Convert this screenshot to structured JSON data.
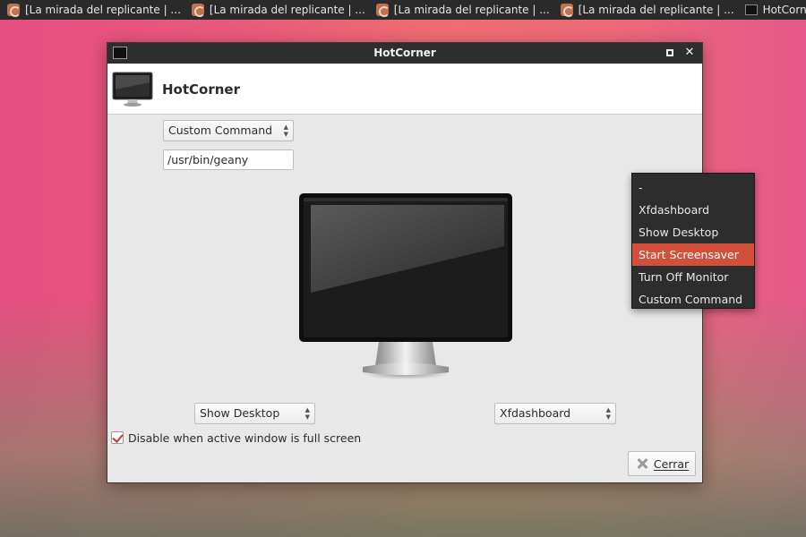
{
  "taskbar": {
    "tasks": [
      {
        "label": "[La mirada del replicante | ...",
        "icon": "firefox-icon"
      },
      {
        "label": "[La mirada del replicante | ...",
        "icon": "firefox-icon"
      },
      {
        "label": "[La mirada del replicante | ...",
        "icon": "firefox-icon"
      },
      {
        "label": "[La mirada del replicante | ...",
        "icon": "firefox-icon"
      },
      {
        "label": "HotCorner",
        "icon": "monitor-icon"
      }
    ]
  },
  "window": {
    "title": "HotCorner",
    "header_title": "HotCorner",
    "top_left": {
      "selected": "Custom Command",
      "command_value": "/usr/bin/geany"
    },
    "top_right_menu": {
      "items": [
        "-",
        "Xfdashboard",
        "Show Desktop",
        "Start Screensaver",
        "Turn Off Monitor",
        "Custom Command"
      ],
      "highlighted": "Start Screensaver",
      "highlight_color": "#d2503a"
    },
    "bottom_left": {
      "selected": "Show Desktop"
    },
    "bottom_right": {
      "selected": "Xfdashboard"
    },
    "fullscreen_check": {
      "label": "Disable when active window is full screen",
      "checked": true
    },
    "close_button": {
      "label": "Cerrar"
    }
  }
}
